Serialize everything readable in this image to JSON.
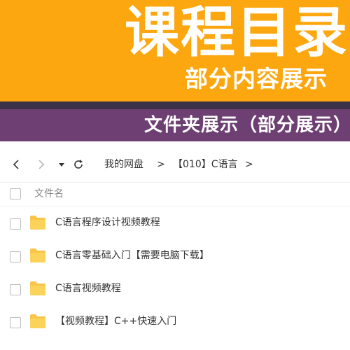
{
  "banner": {
    "title": "课程目录",
    "subtitle": "部分内容展示"
  },
  "section_bar": {
    "text": "文件夹展示（部分展示）"
  },
  "nav": {
    "back_icon": "chevron-left-icon",
    "forward_icon": "chevron-right-icon",
    "dropdown_icon": "caret-down-icon",
    "refresh_icon": "refresh-icon",
    "breadcrumbs": [
      "我的网盘",
      "【010】C语言"
    ],
    "separator": ">"
  },
  "file_list": {
    "header": "文件名",
    "items": [
      {
        "name": "C语言程序设计视频教程",
        "icon": "folder-icon"
      },
      {
        "name": "C语言零基础入门【需要电脑下载】",
        "icon": "folder-icon"
      },
      {
        "name": "C语言视频教程",
        "icon": "folder-icon"
      },
      {
        "name": "【视频教程】C++快速入门",
        "icon": "folder-icon"
      }
    ]
  },
  "colors": {
    "banner_bg": "#fca70f",
    "strip_dark": "#3b3149",
    "section_bar_bg": "#6d3f72",
    "folder": "#f8c54a"
  }
}
